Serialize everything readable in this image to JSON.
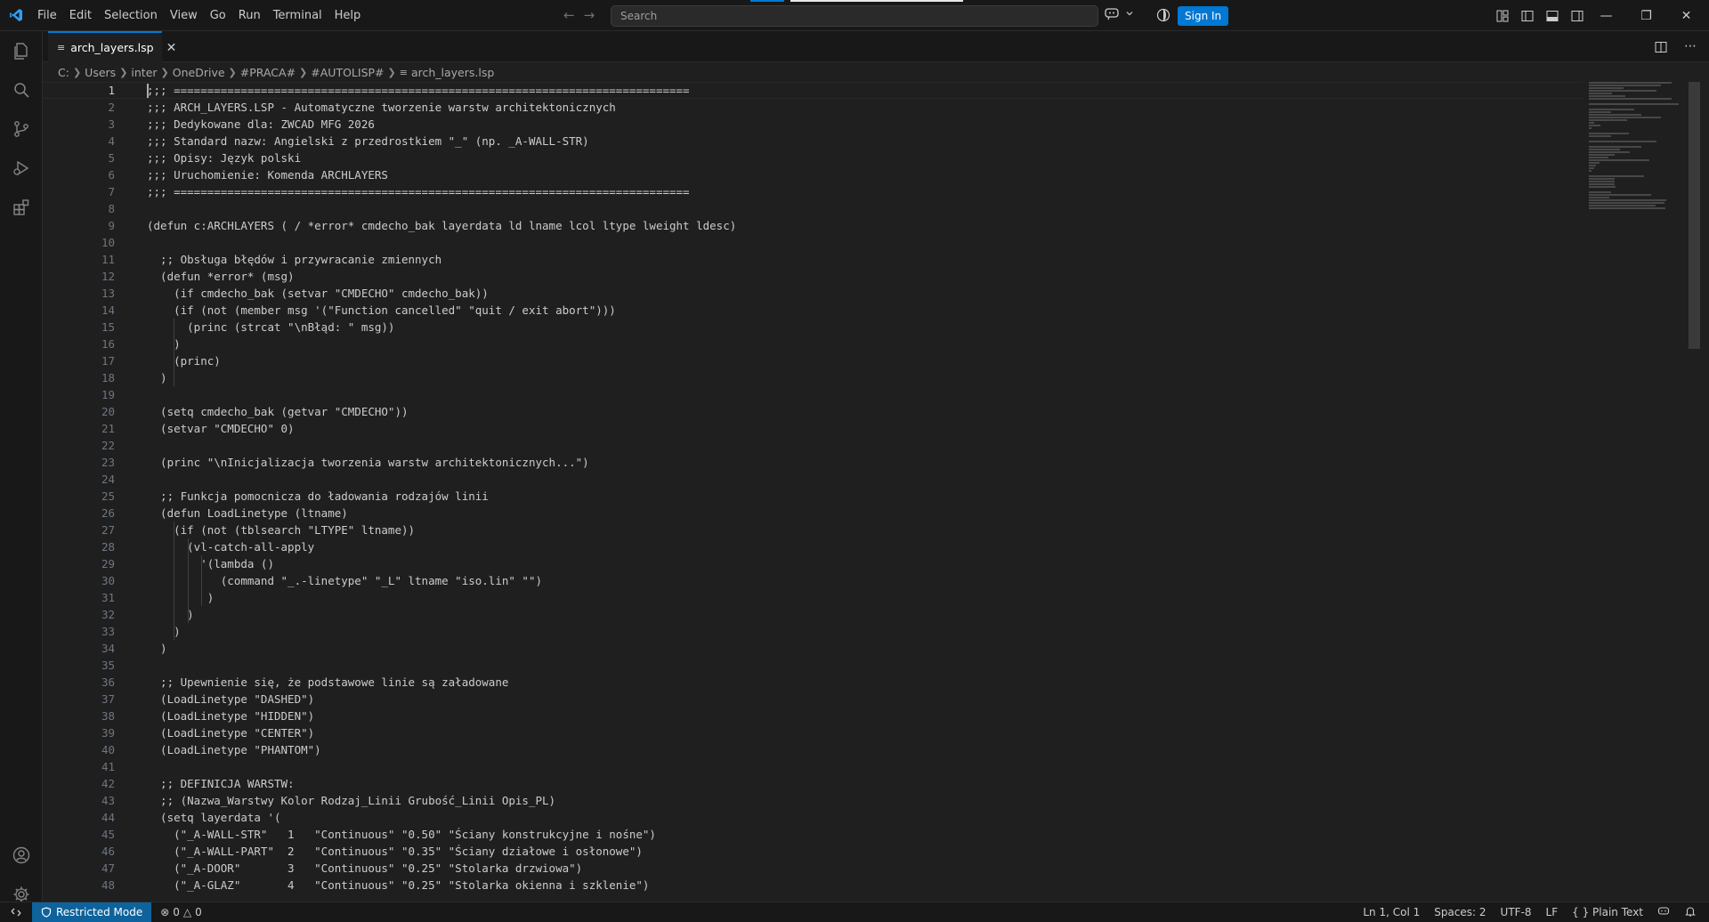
{
  "menu": [
    "File",
    "Edit",
    "Selection",
    "View",
    "Go",
    "Run",
    "Terminal",
    "Help"
  ],
  "search": {
    "placeholder": "Search"
  },
  "signin": "Sign In",
  "tab": {
    "label": "arch_layers.lsp"
  },
  "breadcrumb": [
    "C:",
    "Users",
    "inter",
    "OneDrive",
    "#PRACA#",
    "#AUTOLISP#",
    "arch_layers.lsp"
  ],
  "editor": {
    "lines": [
      ";;; =============================================================================",
      ";;; ARCH_LAYERS.LSP - Automatyczne tworzenie warstw architektonicznych",
      ";;; Dedykowane dla: ZWCAD MFG 2026",
      ";;; Standard nazw: Angielski z przedrostkiem \"_\" (np. _A-WALL-STR)",
      ";;; Opisy: Język polski",
      ";;; Uruchomienie: Komenda ARCHLAYERS",
      ";;; =============================================================================",
      "",
      "(defun c:ARCHLAYERS ( / *error* cmdecho_bak layerdata ld lname lcol ltype lweight ldesc)",
      "",
      "  ;; Obsługa błędów i przywracanie zmiennych",
      "  (defun *error* (msg)",
      "    (if cmdecho_bak (setvar \"CMDECHO\" cmdecho_bak))",
      "    (if (not (member msg '(\"Function cancelled\" \"quit / exit abort\")))",
      "      (princ (strcat \"\\nBłąd: \" msg))",
      "    )",
      "    (princ)",
      "  )",
      "",
      "  (setq cmdecho_bak (getvar \"CMDECHO\"))",
      "  (setvar \"CMDECHO\" 0)",
      "",
      "  (princ \"\\nInicjalizacja tworzenia warstw architektonicznych...\")",
      "",
      "  ;; Funkcja pomocnicza do ładowania rodzajów linii",
      "  (defun LoadLinetype (ltname)",
      "    (if (not (tblsearch \"LTYPE\" ltname))",
      "      (vl-catch-all-apply",
      "        '(lambda ()",
      "           (command \"_.-linetype\" \"_L\" ltname \"iso.lin\" \"\")",
      "         )",
      "      )",
      "    )",
      "  )",
      "",
      "  ;; Upewnienie się, że podstawowe linie są załadowane",
      "  (LoadLinetype \"DASHED\")",
      "  (LoadLinetype \"HIDDEN\")",
      "  (LoadLinetype \"CENTER\")",
      "  (LoadLinetype \"PHANTOM\")",
      "",
      "  ;; DEFINICJA WARSTW:",
      "  ;; (Nazwa_Warstwy Kolor Rodzaj_Linii Grubość_Linii Opis_PL)",
      "  (setq layerdata '(",
      "    (\"_A-WALL-STR\"   1   \"Continuous\" \"0.50\" \"Ściany konstrukcyjne i nośne\")",
      "    (\"_A-WALL-PART\"  2   \"Continuous\" \"0.35\" \"Ściany działowe i osłonowe\")",
      "    (\"_A-DOOR\"       3   \"Continuous\" \"0.25\" \"Stolarka drzwiowa\")",
      "    (\"_A-GLAZ\"       4   \"Continuous\" \"0.25\" \"Stolarka okienna i szklenie\")"
    ]
  },
  "status": {
    "mode": "Restricted Mode",
    "errors": "0",
    "warnings": "0",
    "position": "Ln 1, Col 1",
    "spaces": "Spaces: 2",
    "encoding": "UTF-8",
    "eol": "LF",
    "language": "Plain Text",
    "language_icon": "{ }"
  },
  "colors": {
    "accent": "#0078d4",
    "restricted_bg": "#0e639c",
    "editor_bg": "#1f1f1f",
    "chrome_bg": "#181818"
  }
}
